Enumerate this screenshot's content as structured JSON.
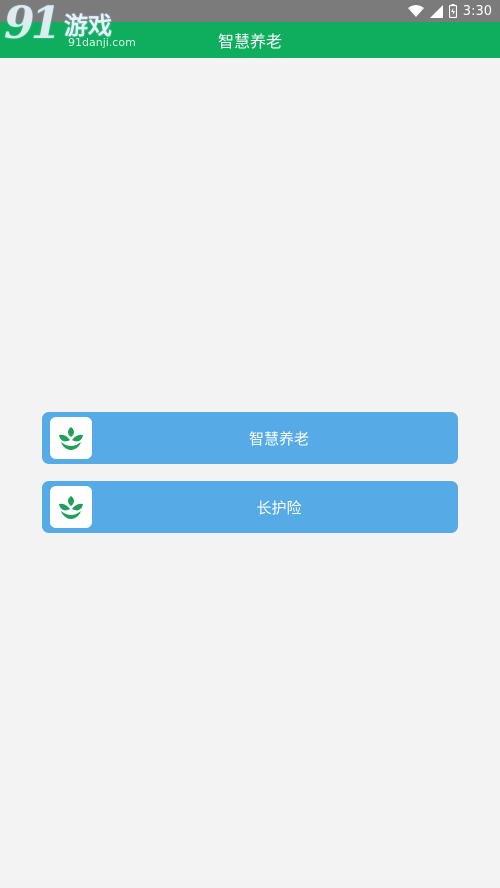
{
  "status_bar": {
    "time": "3:30",
    "icons": [
      "wifi-icon",
      "signal-icon",
      "battery-icon"
    ]
  },
  "header": {
    "title": "智慧养老"
  },
  "watermark": {
    "big_text": "91",
    "cn_text": "游戏",
    "url": "91danji.com"
  },
  "menu": {
    "items": [
      {
        "label": "智慧养老",
        "icon": "green-leaf-logo-icon"
      },
      {
        "label": "长护险",
        "icon": "green-leaf-logo-icon"
      }
    ]
  },
  "colors": {
    "header_bg": "#0eae5e",
    "button_bg": "#56aae6",
    "page_bg": "#f3f3f3",
    "logo_green": "#1fa05a"
  }
}
